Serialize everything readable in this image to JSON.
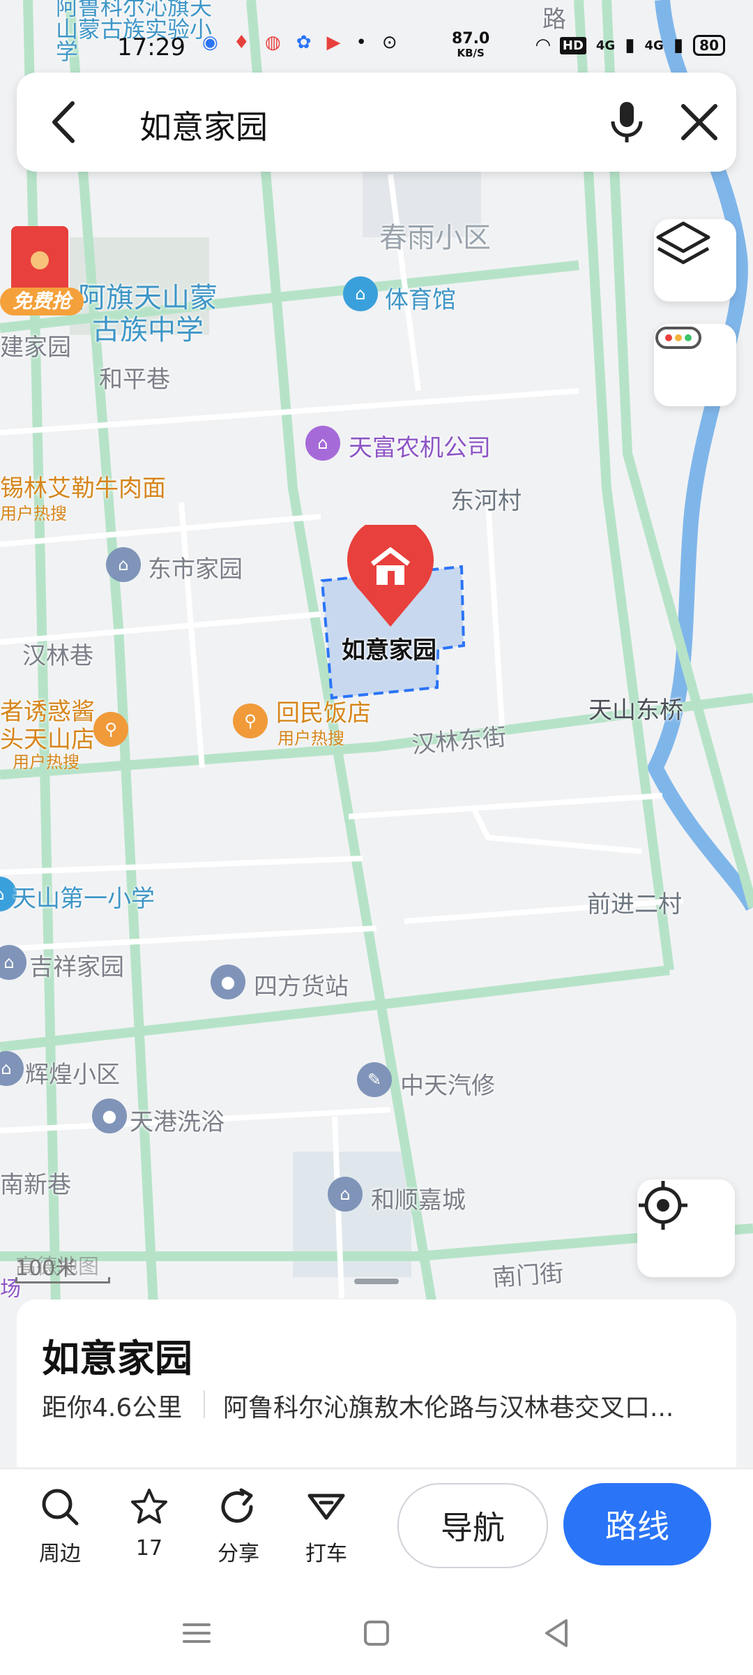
{
  "status": {
    "time": "17:29",
    "net_speed_value": "87.0",
    "net_speed_unit": "KB/S",
    "hd_badge": "HD",
    "net1": "4G",
    "net2": "4G",
    "battery": "80"
  },
  "search": {
    "query": "如意家园"
  },
  "map": {
    "labels": {
      "road_top": "路",
      "school_mongol_top": "阿鲁科尔沁旗天山蒙古族实验小学",
      "chunyu": "春雨小区",
      "tiyuguan": "体育馆",
      "mongol_middle_1": "阿旗天山蒙",
      "mongol_middle_2": "古族中学",
      "jianjiayuan": "建家园",
      "redpacket": "免费抢",
      "heping": "和平巷",
      "tianfu": "天富农机公司",
      "xilin_1": "锡林艾勒牛肉面",
      "xilin_sub": "用户热搜",
      "donghe": "东河村",
      "dongshi": "东市家园",
      "hanlin_lane": "汉林巷",
      "target": "如意家园",
      "zhe_1": "者诱惑酱",
      "zhe_2": "头天山店",
      "zhe_sub": "用户热搜",
      "huimin": "回民饭店",
      "huimin_sub": "用户热搜",
      "hanlin_east": "汉林东街",
      "tianshan_bridge": "天山东桥",
      "first_school": "天山第一小学",
      "qianjin": "前进二村",
      "jixiang": "吉祥家园",
      "sifang": "四方货站",
      "huihuang": "辉煌小区",
      "zhongtian": "中天汽修",
      "tiangang": "天港洗浴",
      "nanxin": "南新巷",
      "heshun": "和顺嘉城",
      "nanmen": "南门街",
      "chang": "场",
      "scale": "100米",
      "watermark": "高德地图"
    }
  },
  "card": {
    "title": "如意家园",
    "distance": "距你4.6公里",
    "address": "阿鲁科尔沁旗敖木伦路与汉林巷交叉口..."
  },
  "actions": {
    "nearby": "周边",
    "favorite_count": "17",
    "share": "分享",
    "taxi": "打车",
    "navigate": "导航",
    "route": "路线"
  },
  "colors": {
    "accent": "#2a74f7",
    "marker": "#e8403c",
    "river": "#7fb6ea",
    "road": "#b6e3c8"
  }
}
